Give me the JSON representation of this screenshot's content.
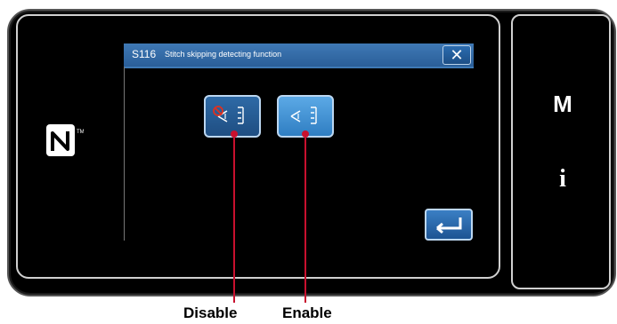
{
  "panel": {
    "title_code": "S116",
    "title_text": "Stitch skipping detecting function",
    "close_label": "✕"
  },
  "options": [
    {
      "id": "disable",
      "icon": "sensor-off-icon"
    },
    {
      "id": "enable",
      "icon": "sensor-on-icon"
    }
  ],
  "side_keys": {
    "m_label": "M",
    "i_label": "i"
  },
  "icons": {
    "nfc": "nfc-icon",
    "enter": "enter-icon"
  },
  "captions": {
    "disable": "Disable",
    "enable": "Enable"
  },
  "colors": {
    "titlebar": "#3f79b5",
    "button": "#2a6aa8",
    "callout": "#c8102e"
  }
}
